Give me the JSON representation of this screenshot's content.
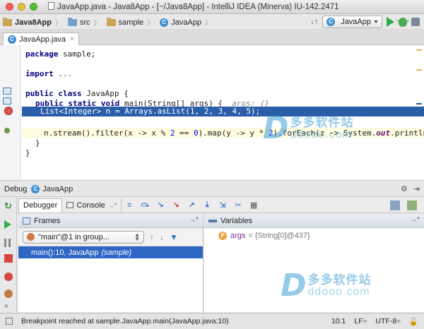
{
  "window": {
    "title": "JavaApp.java - Java8App - [~/Java8App] - IntelliJ IDEA (Minerva) IU-142.2471",
    "colors": {
      "close": "#fc5b57",
      "minimize": "#e5bf3c",
      "zoom": "#57c038"
    }
  },
  "navbar": {
    "breadcrumbs": [
      "Java8App",
      "src",
      "sample",
      "JavaApp"
    ],
    "run_config": "JavaApp"
  },
  "editor": {
    "tab_label": "JavaApp.java",
    "code": {
      "l1_kw": "package",
      "l1_rest": " sample;",
      "l2_kw": "import",
      "l2_rest": " ...",
      "l3_kw1": "public",
      "l3_kw2": " class",
      "l3_rest": " JavaApp {",
      "l4_kw1": "public",
      "l4_kw2": " static",
      "l4_kw3": " void",
      "l4_rest": " main(String[] args) {",
      "l4_hint": "  args: {}",
      "l5": "List<Integer> n = Arrays.asList(1, 2, 3, 4, 5);",
      "l6_a": "n.stream().filter(x -> x % ",
      "l6_n1": "2",
      "l6_b": " == ",
      "l6_n2": "0",
      "l6_c": ").map(y -> y * ",
      "l6_n3": "2",
      "l6_d": ").forEach(z -> System.",
      "l6_field": "out",
      "l6_e": ".println",
      "l7": "}",
      "l8": "}"
    },
    "highlight_color": "#2b5ea8"
  },
  "watermark": {
    "cn": "多多软件站",
    "en": "ddooo.com"
  },
  "debug": {
    "title": "Debug",
    "config": "JavaApp",
    "tabs": {
      "debugger": "Debugger",
      "console": "Console"
    },
    "frames": {
      "title": "Frames",
      "thread": "\"main\"@1 in group...",
      "frame_method": "main():10, JavaApp",
      "frame_package": "(sample)"
    },
    "variables": {
      "title": "Variables",
      "items": [
        {
          "name": "args",
          "value": "= {String[0]@437}"
        }
      ]
    }
  },
  "status": {
    "message": "Breakpoint reached at sample.JavaApp.main(JavaApp.java:10)",
    "position": "10:1",
    "line_sep": "LF÷",
    "encoding": "UTF-8÷"
  }
}
